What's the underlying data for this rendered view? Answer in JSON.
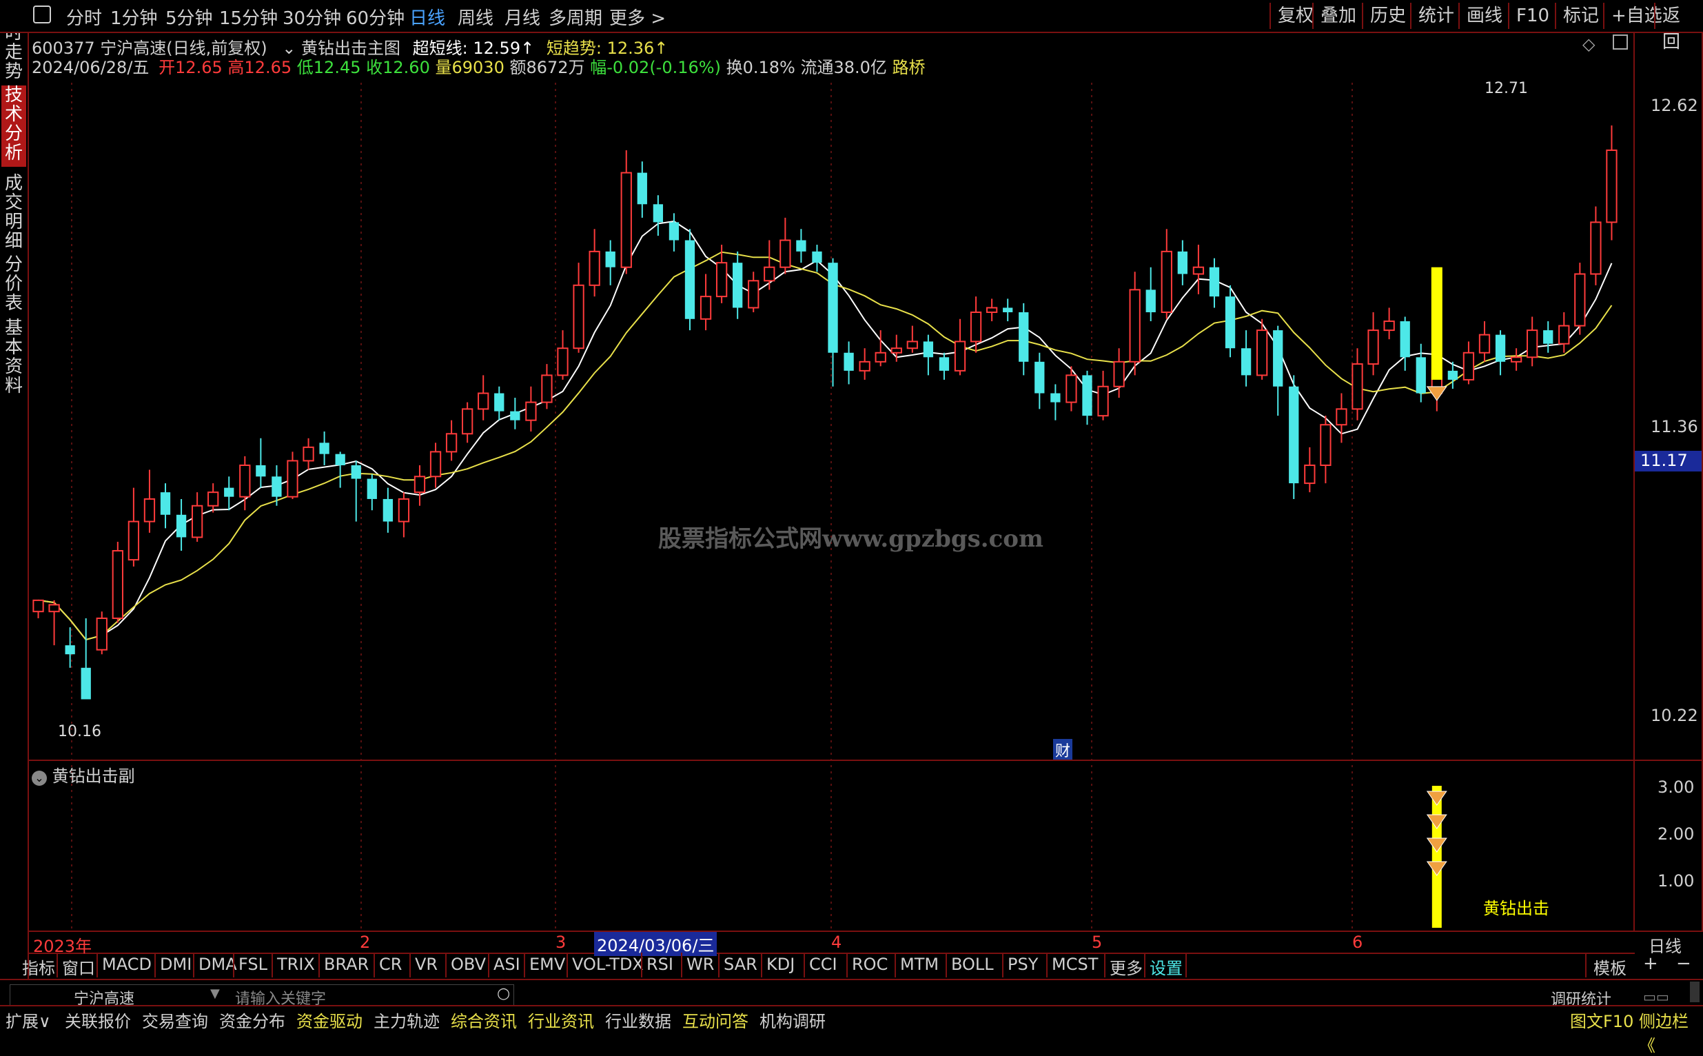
{
  "toolbar": {
    "periods": [
      "分时",
      "1分钟",
      "5分钟",
      "15分钟",
      "30分钟",
      "60分钟",
      "日线",
      "周线",
      "月线",
      "多周期",
      "更多 >"
    ],
    "active": "日线",
    "right_buttons": [
      "复权",
      "叠加",
      "历史",
      "统计",
      "画线",
      "F10",
      "标记",
      "+自选",
      "返回"
    ]
  },
  "left_tabs": [
    "分时走势",
    "技术分析",
    "成交明细",
    "分价表",
    "基本资料"
  ],
  "left_tab_active": "技术分析",
  "header": {
    "stock": "600377 宁沪高速(日线,前复权)",
    "indicator_name": "黄钻出击主图",
    "chao_label": "超短线:",
    "chao_value": "12.59↑",
    "duan_label": "短趋势:",
    "duan_value": "12.36↑",
    "date": "2024/06/28/五",
    "open": "开12.65",
    "high": "高12.65",
    "low": "低12.45",
    "close": "收12.60",
    "volume": "量69030",
    "amount": "额8672万",
    "change": "幅-0.02(-0.16%)",
    "turnover": "换0.18%",
    "float_cap": "流通38.0亿",
    "luqiao": "路桥"
  },
  "watermark": "股票指标公式网www.gpzbgs.com",
  "price_axis": [
    "12.62",
    "11.36",
    "10.22"
  ],
  "price_marker": "11.17",
  "annotations": {
    "high": "12.71",
    "low": "10.16",
    "cai": "财"
  },
  "sub_panel": {
    "title": "黄钻出击副",
    "axis": [
      "3.00",
      "2.00",
      "1.00"
    ],
    "signal_label": "黄钻出击"
  },
  "date_axis": {
    "labels": [
      "2023年",
      "2",
      "3",
      "4",
      "5",
      "6"
    ],
    "highlight": "2024/03/06/三",
    "period": "日线"
  },
  "indicator_tabs": [
    "指标",
    "窗口",
    "MACD",
    "DMI",
    "DMA",
    "FSL",
    "TRIX",
    "BRAR",
    "CR",
    "VR",
    "OBV",
    "ASI",
    "EMV",
    "VOL-TDX",
    "RSI",
    "WR",
    "SAR",
    "KDJ",
    "CCI",
    "ROC",
    "MTM",
    "BOLL",
    "PSY",
    "MCST",
    "更多",
    "设置"
  ],
  "template_btn": "模板",
  "plus_minus": [
    "+",
    "−"
  ],
  "search": {
    "stock": "宁沪高速",
    "placeholder": "请输入关键字",
    "right": "调研统计"
  },
  "footer_tabs": [
    "扩展∨",
    "关联报价",
    "交易查询",
    "资金分布",
    "资金驱动",
    "主力轨迹",
    "综合资讯",
    "行业资讯",
    "行业数据",
    "互动问答",
    "机构调研"
  ],
  "footer_right": [
    "图文F10",
    "侧边栏《"
  ],
  "colors": {
    "up": "#ff3b3b",
    "down": "#4de8e8",
    "ma_white": "#ffffff",
    "ma_yellow": "#e8e04a",
    "signal": "#ffff00",
    "border": "#7a1010",
    "active_blue": "#4aa3ff"
  },
  "chart_data": {
    "type": "candlestick",
    "ylim": [
      9.99,
      12.9
    ],
    "x_count": 100,
    "candles": [
      [
        10.55,
        10.6,
        10.58,
        10.52
      ],
      [
        10.55,
        10.58,
        10.6,
        10.4
      ],
      [
        10.4,
        10.36,
        10.48,
        10.3
      ],
      [
        10.3,
        10.16,
        10.52,
        10.16
      ],
      [
        10.38,
        10.52,
        10.55,
        10.36
      ],
      [
        10.52,
        10.82,
        10.86,
        10.5
      ],
      [
        10.78,
        10.95,
        11.1,
        10.75
      ],
      [
        10.95,
        11.05,
        11.18,
        10.9
      ],
      [
        11.08,
        10.98,
        11.12,
        10.92
      ],
      [
        10.98,
        10.88,
        11.05,
        10.82
      ],
      [
        10.88,
        11.02,
        11.08,
        10.86
      ],
      [
        11.02,
        11.08,
        11.12,
        10.99
      ],
      [
        11.1,
        11.06,
        11.15,
        11.0
      ],
      [
        11.06,
        11.2,
        11.24,
        11.0
      ],
      [
        11.2,
        11.15,
        11.32,
        11.1
      ],
      [
        11.15,
        11.06,
        11.2,
        11.02
      ],
      [
        11.06,
        11.22,
        11.26,
        11.05
      ],
      [
        11.22,
        11.28,
        11.32,
        11.18
      ],
      [
        11.3,
        11.25,
        11.35,
        11.2
      ],
      [
        11.25,
        11.2,
        11.26,
        11.1
      ],
      [
        11.2,
        11.14,
        11.22,
        10.95
      ],
      [
        11.14,
        11.05,
        11.16,
        11.0
      ],
      [
        11.05,
        10.95,
        11.1,
        10.9
      ],
      [
        10.95,
        11.05,
        11.08,
        10.88
      ],
      [
        11.08,
        11.15,
        11.2,
        11.02
      ],
      [
        11.15,
        11.26,
        11.3,
        11.1
      ],
      [
        11.26,
        11.34,
        11.4,
        11.22
      ],
      [
        11.34,
        11.45,
        11.48,
        11.3
      ],
      [
        11.45,
        11.52,
        11.6,
        11.4
      ],
      [
        11.52,
        11.44,
        11.55,
        11.4
      ],
      [
        11.44,
        11.4,
        11.5,
        11.36
      ],
      [
        11.4,
        11.48,
        11.55,
        11.35
      ],
      [
        11.48,
        11.6,
        11.65,
        11.45
      ],
      [
        11.6,
        11.72,
        11.8,
        11.58
      ],
      [
        11.72,
        12.0,
        12.1,
        11.7
      ],
      [
        12.0,
        12.15,
        12.25,
        11.95
      ],
      [
        12.15,
        12.08,
        12.2,
        12.0
      ],
      [
        12.08,
        12.5,
        12.6,
        12.05
      ],
      [
        12.5,
        12.36,
        12.55,
        12.3
      ],
      [
        12.36,
        12.28,
        12.4,
        12.22
      ],
      [
        12.28,
        12.2,
        12.32,
        12.15
      ],
      [
        12.2,
        11.85,
        12.25,
        11.8
      ],
      [
        11.85,
        11.95,
        12.05,
        11.8
      ],
      [
        11.95,
        12.1,
        12.18,
        11.92
      ],
      [
        12.1,
        11.9,
        12.15,
        11.85
      ],
      [
        11.9,
        12.02,
        12.06,
        11.88
      ],
      [
        12.02,
        12.08,
        12.2,
        11.98
      ],
      [
        12.08,
        12.2,
        12.3,
        12.05
      ],
      [
        12.2,
        12.15,
        12.25,
        12.1
      ],
      [
        12.15,
        12.1,
        12.18,
        12.06
      ],
      [
        12.1,
        11.7,
        12.12,
        11.55
      ],
      [
        11.7,
        11.62,
        11.75,
        11.56
      ],
      [
        11.62,
        11.66,
        11.72,
        11.58
      ],
      [
        11.66,
        11.7,
        11.8,
        11.64
      ],
      [
        11.7,
        11.72,
        11.78,
        11.66
      ],
      [
        11.72,
        11.75,
        11.82,
        11.7
      ],
      [
        11.75,
        11.68,
        11.78,
        11.6
      ],
      [
        11.68,
        11.62,
        11.7,
        11.58
      ],
      [
        11.62,
        11.75,
        11.85,
        11.6
      ],
      [
        11.75,
        11.88,
        11.95,
        11.7
      ],
      [
        11.88,
        11.9,
        11.94,
        11.84
      ],
      [
        11.9,
        11.88,
        11.94,
        11.84
      ],
      [
        11.88,
        11.66,
        11.92,
        11.6
      ],
      [
        11.66,
        11.52,
        11.7,
        11.45
      ],
      [
        11.52,
        11.48,
        11.56,
        11.4
      ],
      [
        11.48,
        11.6,
        11.64,
        11.44
      ],
      [
        11.6,
        11.42,
        11.62,
        11.38
      ],
      [
        11.42,
        11.55,
        11.62,
        11.4
      ],
      [
        11.55,
        11.66,
        11.72,
        11.5
      ],
      [
        11.66,
        11.98,
        12.06,
        11.6
      ],
      [
        11.98,
        11.88,
        12.08,
        11.84
      ],
      [
        11.88,
        12.15,
        12.25,
        11.85
      ],
      [
        12.15,
        12.05,
        12.2,
        12.0
      ],
      [
        12.05,
        12.08,
        12.18,
        11.96
      ],
      [
        12.08,
        11.95,
        12.12,
        11.9
      ],
      [
        11.95,
        11.72,
        12.0,
        11.68
      ],
      [
        11.72,
        11.6,
        11.8,
        11.55
      ],
      [
        11.6,
        11.8,
        11.85,
        11.58
      ],
      [
        11.8,
        11.55,
        11.82,
        11.42
      ],
      [
        11.55,
        11.12,
        11.6,
        11.05
      ],
      [
        11.12,
        11.2,
        11.28,
        11.08
      ],
      [
        11.2,
        11.38,
        11.42,
        11.12
      ],
      [
        11.38,
        11.45,
        11.52,
        11.3
      ],
      [
        11.45,
        11.65,
        11.72,
        11.4
      ],
      [
        11.65,
        11.8,
        11.88,
        11.6
      ],
      [
        11.8,
        11.84,
        11.9,
        11.76
      ],
      [
        11.84,
        11.68,
        11.86,
        11.62
      ],
      [
        11.68,
        11.52,
        11.74,
        11.48
      ],
      [
        11.52,
        11.62,
        11.68,
        11.44
      ],
      [
        11.62,
        11.58,
        11.66,
        11.54
      ],
      [
        11.58,
        11.7,
        11.75,
        11.56
      ],
      [
        11.7,
        11.78,
        11.84,
        11.66
      ],
      [
        11.78,
        11.66,
        11.8,
        11.6
      ],
      [
        11.66,
        11.68,
        11.72,
        11.62
      ],
      [
        11.68,
        11.8,
        11.86,
        11.64
      ],
      [
        11.8,
        11.74,
        11.84,
        11.7
      ],
      [
        11.74,
        11.82,
        11.88,
        11.7
      ],
      [
        11.82,
        12.05,
        12.1,
        11.78
      ],
      [
        12.05,
        12.28,
        12.35,
        12.0
      ],
      [
        12.28,
        12.6,
        12.71,
        12.2
      ]
    ],
    "signal_bar": {
      "index": 88,
      "top": 12.08,
      "bottom": 11.58
    },
    "sub_signal": {
      "index": 88,
      "max": 3.0
    }
  }
}
